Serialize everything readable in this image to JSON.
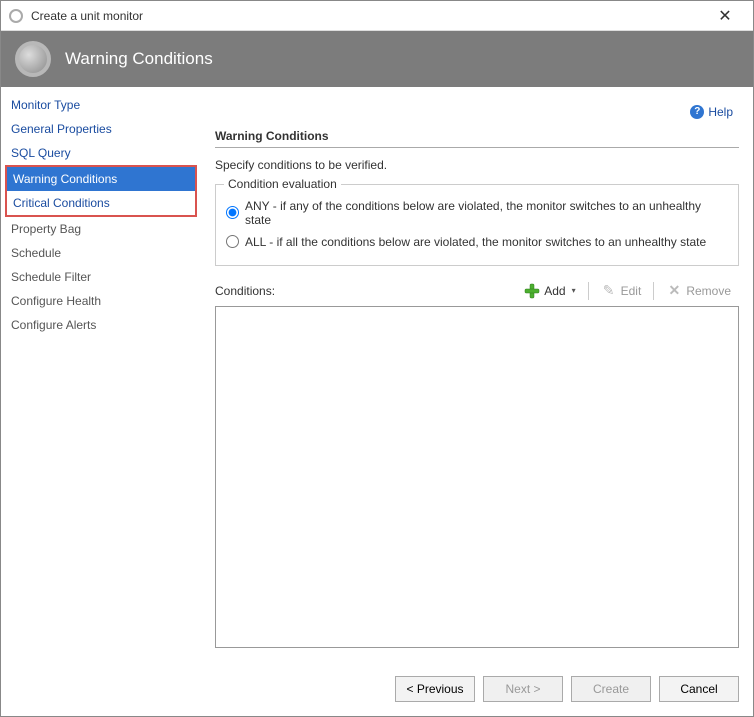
{
  "window": {
    "title": "Create a unit monitor"
  },
  "banner": {
    "title": "Warning Conditions"
  },
  "help": {
    "label": "Help"
  },
  "sidebar": {
    "items": [
      {
        "label": "Monitor Type",
        "state": "visited"
      },
      {
        "label": "General Properties",
        "state": "visited"
      },
      {
        "label": "SQL Query",
        "state": "visited"
      },
      {
        "label": "Warning Conditions",
        "state": "current"
      },
      {
        "label": "Critical Conditions",
        "state": "visited"
      },
      {
        "label": "Property Bag",
        "state": "disabled"
      },
      {
        "label": "Schedule",
        "state": "disabled"
      },
      {
        "label": "Schedule Filter",
        "state": "disabled"
      },
      {
        "label": "Configure Health",
        "state": "disabled"
      },
      {
        "label": "Configure Alerts",
        "state": "disabled"
      }
    ]
  },
  "content": {
    "heading": "Warning Conditions",
    "subtext": "Specify conditions to be verified.",
    "group_legend": "Condition evaluation",
    "radio_any": "ANY - if any of the conditions below are violated, the monitor switches to an unhealthy state",
    "radio_all": "ALL - if all the conditions below are violated, the monitor switches to an unhealthy state",
    "radio_selected": "any",
    "conditions_label": "Conditions:",
    "toolbar": {
      "add": "Add",
      "edit": "Edit",
      "remove": "Remove"
    }
  },
  "footer": {
    "previous": "< Previous",
    "next": "Next >",
    "create": "Create",
    "cancel": "Cancel"
  }
}
